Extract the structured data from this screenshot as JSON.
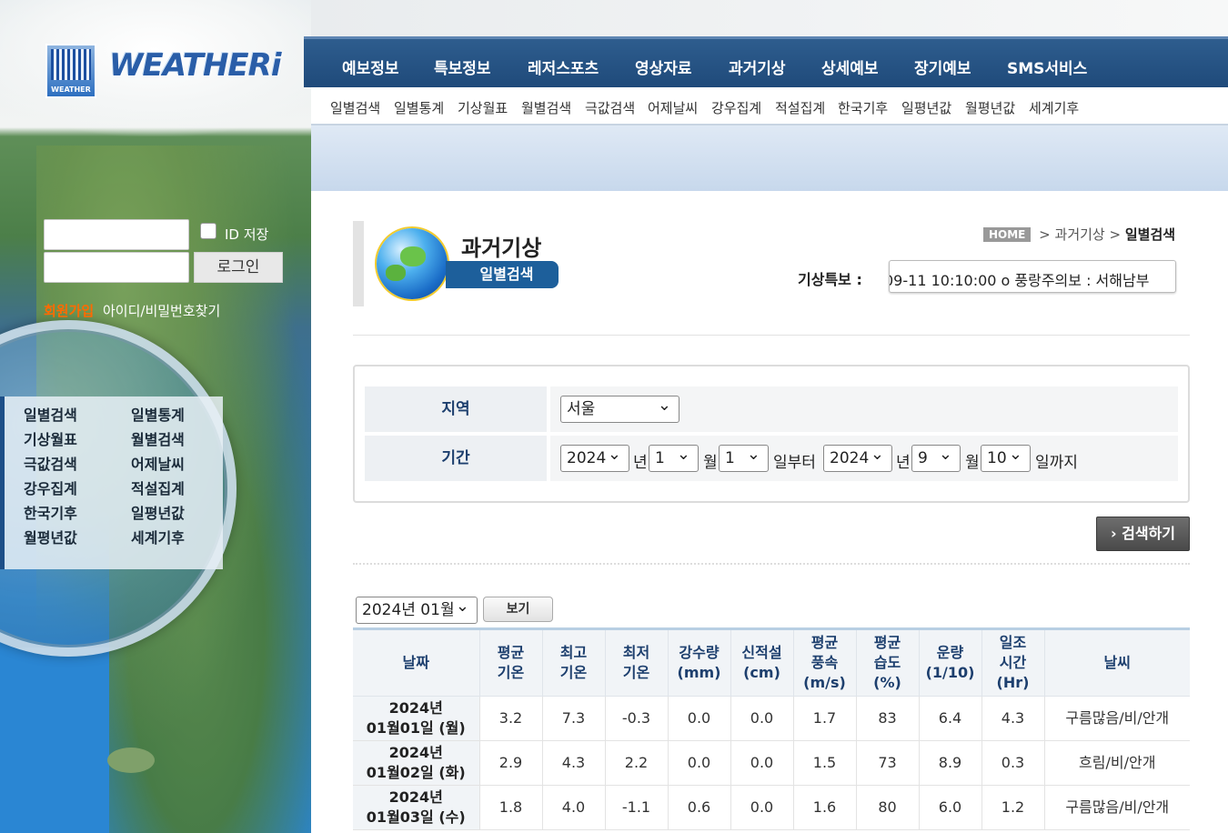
{
  "logo": {
    "mark_text": "WEATHER",
    "text": "WEATHERi"
  },
  "main_nav": [
    "예보정보",
    "특보정보",
    "레저스포츠",
    "영상자료",
    "과거기상",
    "상세예보",
    "장기예보",
    "SMS서비스"
  ],
  "sub_nav": [
    "일별검색",
    "일별통계",
    "기상월표",
    "월별검색",
    "극값검색",
    "어제날씨",
    "강우집계",
    "적설집계",
    "한국기후",
    "일평년값",
    "월평년값",
    "세계기후"
  ],
  "login": {
    "id_save": "ID 저장",
    "button": "로그인",
    "join": "회원가입",
    "find": "아이디/비밀번호찾기"
  },
  "side_menu": [
    "일별검색",
    "일별통계",
    "기상월표",
    "월별검색",
    "극값검색",
    "어제날씨",
    "강우집계",
    "적설집계",
    "한국기후",
    "일평년값",
    "월평년값",
    "세계기후"
  ],
  "page": {
    "title": "과거기상",
    "subtitle": "일별검색"
  },
  "breadcrumb": {
    "home": "HOME",
    "parent": "과거기상",
    "current": "일별검색"
  },
  "alert": {
    "label": "기상특보 :",
    "text": "09-11 10:10:00 o 풍랑주의보 : 서해남부"
  },
  "search": {
    "region_label": "지역",
    "region_value": "서울",
    "period_label": "기간",
    "from_year": "2024",
    "from_month": "1",
    "from_day": "1",
    "to_year": "2024",
    "to_month": "9",
    "to_day": "10",
    "unit_year": "년",
    "unit_month": "월",
    "unit_from": "일부터",
    "unit_to": "일까지",
    "button": "검색하기"
  },
  "month_select": "2024년 01월",
  "view_button": "보기",
  "table": {
    "headers": [
      [
        "날짜"
      ],
      [
        "평균",
        "기온"
      ],
      [
        "최고",
        "기온"
      ],
      [
        "최저",
        "기온"
      ],
      [
        "강수량",
        "(mm)"
      ],
      [
        "신적설",
        "(cm)"
      ],
      [
        "평균",
        "풍속",
        "(m/s)"
      ],
      [
        "평균",
        "습도",
        "(%)"
      ],
      [
        "운량",
        "(1/10)"
      ],
      [
        "일조",
        "시간",
        "(Hr)"
      ],
      [
        "날씨"
      ]
    ],
    "rows": [
      {
        "date1": "2024년",
        "date2": "01월01일 (월)",
        "vals": [
          "3.2",
          "7.3",
          "-0.3",
          "0.0",
          "0.0",
          "1.7",
          "83",
          "6.4",
          "4.3",
          "구름많음/비/안개"
        ]
      },
      {
        "date1": "2024년",
        "date2": "01월02일 (화)",
        "vals": [
          "2.9",
          "4.3",
          "2.2",
          "0.0",
          "0.0",
          "1.5",
          "73",
          "8.9",
          "0.3",
          "흐림/비/안개"
        ]
      },
      {
        "date1": "2024년",
        "date2": "01월03일 (수)",
        "vals": [
          "1.8",
          "4.0",
          "-1.1",
          "0.6",
          "0.0",
          "1.6",
          "80",
          "6.0",
          "1.2",
          "구름많음/비/안개"
        ]
      }
    ]
  },
  "colors": {
    "nav_bg": "#1f4a7a",
    "header_text": "#1d3f6e",
    "join_link": "#ff6a00",
    "subtitle_bg": "#1d5f9b"
  }
}
